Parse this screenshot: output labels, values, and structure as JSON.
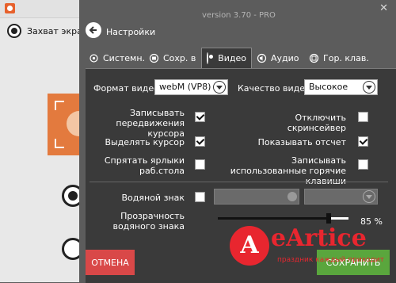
{
  "background_app": {
    "capture_label": "Захват экрана"
  },
  "panel": {
    "version": "version 3.70 - PRO",
    "title": "Настройки",
    "close_glyph": "✕",
    "tabs": [
      {
        "label": "Системн.",
        "icon": "gear-icon",
        "active": false
      },
      {
        "label": "Сохр. в",
        "icon": "folder-icon",
        "active": false
      },
      {
        "label": "Видео",
        "icon": "record-icon",
        "active": true
      },
      {
        "label": "Аудио",
        "icon": "speaker-icon",
        "active": false
      },
      {
        "label": "Гор. клав.",
        "icon": "keyboard-icon",
        "active": false
      }
    ]
  },
  "video": {
    "format_label": "Формат видео",
    "format_value": "webM (VP8)",
    "quality_label": "Качество видео",
    "quality_value": "Высокое",
    "record_cursor_label": "Записывать передвижения курсора",
    "record_cursor_checked": true,
    "disable_screensaver_label": "Отключить скринсейвер",
    "disable_screensaver_checked": false,
    "highlight_cursor_label": "Выделять курсор",
    "highlight_cursor_checked": true,
    "show_countdown_label": "Показывать отсчет",
    "show_countdown_checked": true,
    "hide_icons_label": "Спрятать ярлыки раб.стола",
    "hide_icons_checked": false,
    "record_hotkeys_label": "Записывать использованные горячие клавиши",
    "record_hotkeys_checked": false,
    "watermark_label": "Водяной знак",
    "watermark_checked": false,
    "opacity_label": "Прозрачность водяного знака",
    "opacity_value": "85 %",
    "opacity_fraction": 0.85
  },
  "footer": {
    "cancel_label": "ОТМЕНА",
    "save_label": "СОХРАНИТЬ"
  },
  "watermark_overlay": {
    "logo_letter": "A",
    "brand": "eArtice",
    "tagline": "праздник каждый приходит"
  }
}
